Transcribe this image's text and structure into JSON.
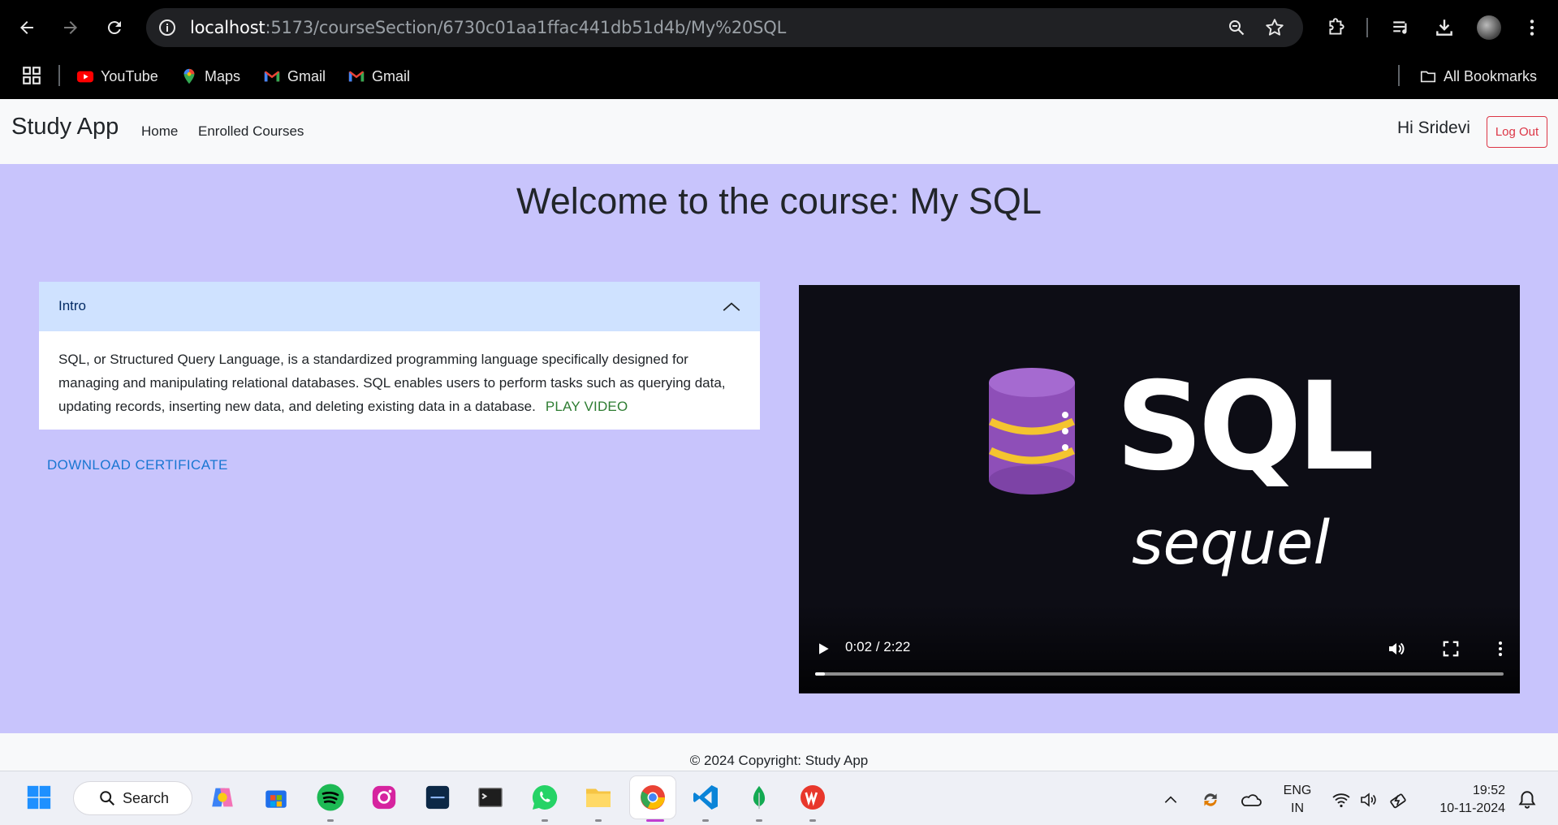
{
  "browser": {
    "url_host": "localhost",
    "url_rest": ":5173/courseSection/6730c01aa1ffac441db51d4b/My%20SQL",
    "bookmarks": [
      {
        "label": "YouTube",
        "icon": "youtube-icon"
      },
      {
        "label": "Maps",
        "icon": "maps-icon"
      },
      {
        "label": "Gmail",
        "icon": "gmail-icon"
      },
      {
        "label": "Gmail",
        "icon": "gmail-icon"
      }
    ],
    "all_bookmarks": "All Bookmarks"
  },
  "nav": {
    "brand": "Study App",
    "links": [
      "Home",
      "Enrolled Courses"
    ],
    "greeting": "Hi Sridevi",
    "logout": "Log Out"
  },
  "main": {
    "welcome": "Welcome to the course: My SQL",
    "section": {
      "title": "Intro",
      "description": "SQL, or Structured Query Language, is a standardized programming language specifically designed for managing and manipulating relational databases. SQL enables users to perform tasks such as querying data, updating records, inserting new data, and deleting existing data in a database.",
      "play_label": "PLAY VIDEO"
    },
    "download_label": "DOWNLOAD CERTIFICATE",
    "video": {
      "title_text": "SQL",
      "subtitle_text": "sequel",
      "time": "0:02 / 2:22",
      "progress": 0.014
    }
  },
  "footer": {
    "copyright": "© 2024 Copyright: Study App"
  },
  "taskbar": {
    "search_label": "Search",
    "lang_line1": "ENG",
    "lang_line2": "IN",
    "time": "19:52",
    "date": "10-11-2024"
  },
  "colors": {
    "page_bg": "#c8c4fc",
    "accordion_header": "#cfe2ff",
    "logout": "#dc3545",
    "play_link": "#2e7d32",
    "download_link": "#1976d2"
  }
}
